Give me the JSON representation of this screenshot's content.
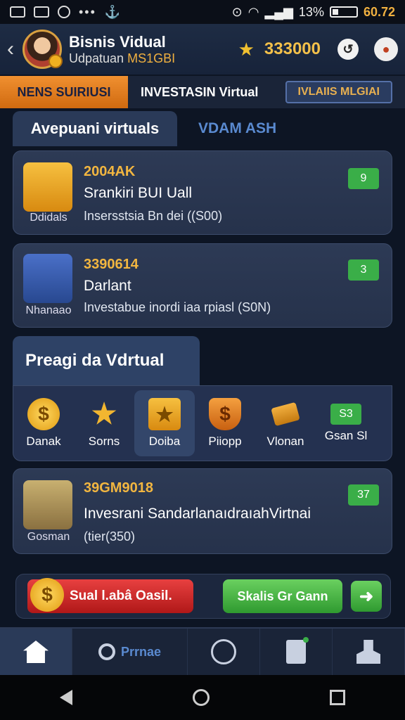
{
  "status": {
    "battery": "13%",
    "time": "60.72"
  },
  "header": {
    "title": "Bisnis Vidual",
    "subtitle": "Udpatuan",
    "subtitle_accent": "MS1GBI",
    "balance": "333000"
  },
  "tabs": [
    "NENS SUIRIUSI",
    "INVESTASIN Virtual",
    "IVLAIIS MLGIAI"
  ],
  "sections": {
    "active": "Avepuani virtuals",
    "inactive": "VDAM ASH"
  },
  "cards": [
    {
      "icon_label": "Ddidals",
      "code": "2004AK",
      "name": "Srankiri BUI Uall",
      "desc": "Insersstsia Bn dei ((S00)",
      "badge": "9"
    },
    {
      "icon_label": "Nhanaao",
      "code": "3390614",
      "name": "Darlant",
      "desc": "Investabue inordi iaa rpiasl (S0N)",
      "badge": "3"
    }
  ],
  "program": {
    "title": "Preagi da Vdrtual",
    "items": [
      "Danak",
      "Sorns",
      "Doiba",
      "Piiopp",
      "Vlonan",
      "Gsan Sl"
    ],
    "badge": "S3"
  },
  "card3": {
    "icon_label": "Gosman",
    "code": "39GM9018",
    "name": "Invesrani SandarlanaıdraıahVirtnai",
    "desc": "(tier(350)",
    "badge": "37"
  },
  "actions": {
    "red": "Sual l.abâ Oasil.",
    "green": "Skalis Gr Gann"
  },
  "nav": {
    "search": "Prrnae"
  }
}
